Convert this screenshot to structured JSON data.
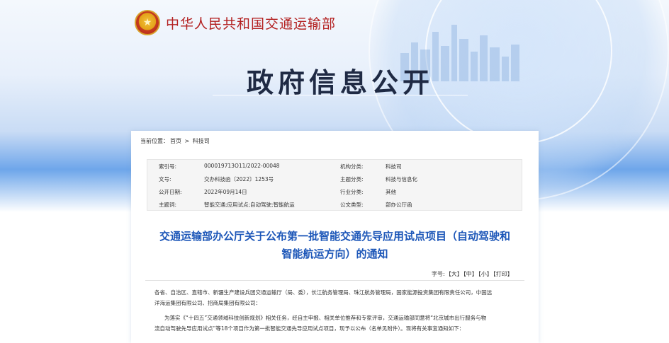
{
  "header": {
    "org_name": "中华人民共和国交通运输部",
    "emblem": "national-emblem",
    "title": "政府信息公开"
  },
  "breadcrumb": {
    "label": "当前位置：",
    "home": "首页",
    "sep": ">",
    "current": "科技司"
  },
  "meta": {
    "index_label": "索引号:",
    "index_value": "000019713O11/2022-00048",
    "org_label": "机构分类:",
    "org_value": "科技司",
    "doc_no_label": "文号:",
    "doc_no_value": "交办科技函〔2022〕1253号",
    "topic_label": "主题分类:",
    "topic_value": "科技与信息化",
    "date_label": "公开日期:",
    "date_value": "2022年09月14日",
    "industry_label": "行业分类:",
    "industry_value": "其他",
    "keywords_label": "主题词:",
    "keywords_value": "智能交通;应用试点;自动驾驶;智能航运",
    "type_label": "公文类型:",
    "type_value": "部办公厅函"
  },
  "article": {
    "title_line1": "交通运输部办公厅关于公布第一批智能交通先导应用试点项目（自动驾驶和",
    "title_line2": "智能航运方向）的通知",
    "font_label": "字号:",
    "font_large": "【大】",
    "font_medium": "【中】",
    "font_small": "【小】",
    "print": "【打印】",
    "para1_line1": "各省、自治区、直辖市、新疆生产建设兵团交通运输厅（局、委），长江航务管理局、珠江航务管理局，国家能源投资集团有限责任公司，中国远",
    "para1_line2": "洋海运集团有限公司、招商局集团有限公司：",
    "para2_line1": "为落实《“十四五”交通领域科技创新规划》相关任务，经自主申报、相关单位推荐和专家评审，交通运输部同意将“北京城市出行服务与物",
    "para2_line2": "流自动驾驶先导应用试点”等18个项目作为第一批智能交通先导应用试点项目，现予以公布（名单见附件）。现将有关事宜通知如下："
  }
}
